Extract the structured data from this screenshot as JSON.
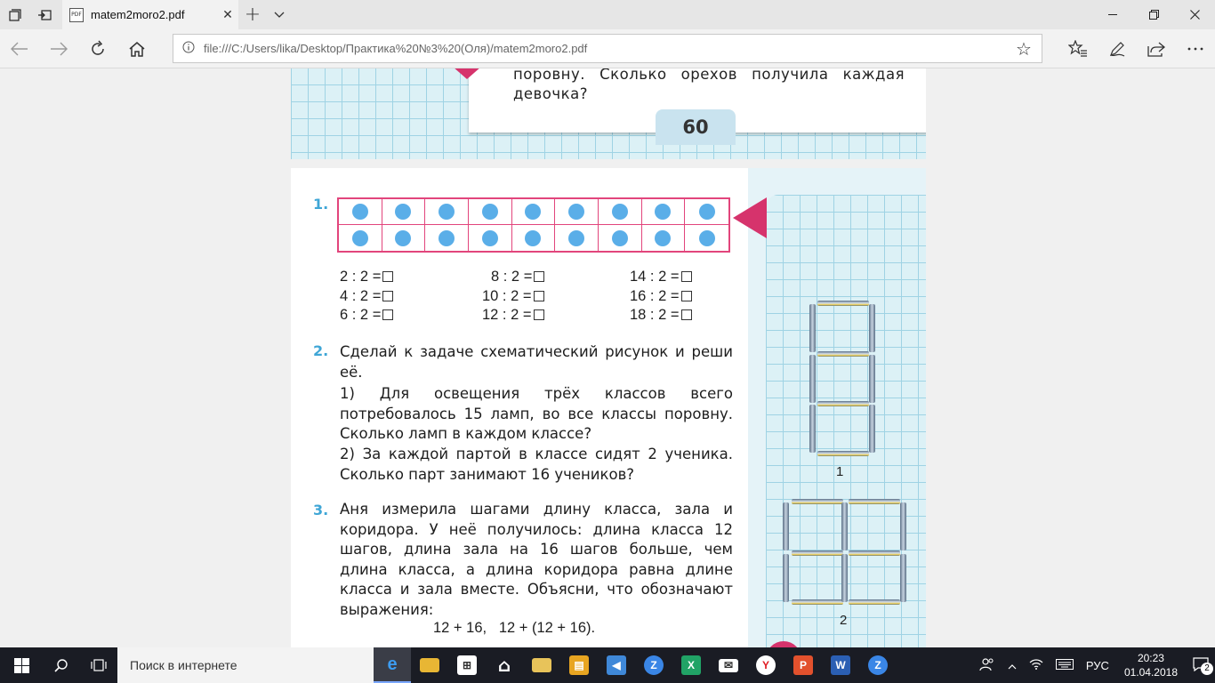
{
  "browser": {
    "tab_title": "matem2moro2.pdf",
    "tab_favicon": "PDF",
    "url": "file:///C:/Users/lika/Desktop/Практика%20№3%20(Оля)/matem2moro2.pdf"
  },
  "page_prev": {
    "text": "поровну. Сколько орехов получила каждая девочка?",
    "page_number": "60"
  },
  "page": {
    "task1_number": "1.",
    "examples": [
      [
        "2 : 2 =",
        "8 : 2 =",
        "14 : 2 ="
      ],
      [
        "4 : 2 =",
        "10 : 2 =",
        "16 : 2 ="
      ],
      [
        "6 : 2 =",
        "12 : 2 =",
        "18 : 2 ="
      ]
    ],
    "task2_number": "2.",
    "task2_text": "Сделай к задаче схематический рисунок и реши её.",
    "task2_sub1": "1) Для освещения трёх классов всего потребовалось 15 ламп, во все классы поровну. Сколько ламп в каждом классе?",
    "task2_sub2": "2) За каждой партой в классе сидят 2 ученика. Сколько парт занимают 16 учеников?",
    "task3_number": "3.",
    "task3_text": "Аня измерила шагами длину класса, зала и коридора. У неё получилось: длина класса 12 шагов, длина зала на 16 шагов больше, чем длина класса, а длина коридора равна длине класса и зала вместе. Объясни, что обозначают выражения:",
    "task3_expr": "12 + 16,   12 + (12 + 16).",
    "figure1_label": "1",
    "figure2_label": "2"
  },
  "taskbar": {
    "search_placeholder": "Поиск в интернете",
    "language": "РУС",
    "time": "20:23",
    "date": "01.04.2018",
    "notification_count": "2"
  }
}
